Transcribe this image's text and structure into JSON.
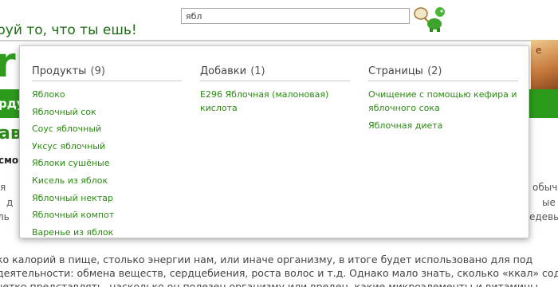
{
  "header": {
    "slogan": "руй то, что ты ешь!",
    "search": {
      "value": "ябл"
    }
  },
  "background": {
    "logo_letter": "r",
    "nav_label": "рду",
    "promo_text": "e",
    "heading": "ав",
    "subheading": "смо",
    "left_fragments": [
      "я",
      "д",
      "ль"
    ],
    "right_fragments": [
      "обыч",
      "ые",
      "едевы"
    ],
    "body_lines": [
      "ко калорий в пище, столько энергии нам, или иначе организму, в итоге будет использовано для под",
      "деятельности: обмена веществ, сердцебиения, роста волос и т.д. Однако мало знать, сколько «ккал» соде",
      "четко представлять, насколько он полезен организму или вреден, какие микроэлементы и витамины"
    ]
  },
  "dropdown": {
    "products": {
      "title": "Продукты",
      "count": "(9)",
      "items": [
        "Яблоко",
        "Яблочный сок",
        "Соус яблочный",
        "Уксус яблочный",
        "Яблоки сушёные",
        "Кисель из яблок",
        "Яблочный нектар",
        "Яблочный компот",
        "Варенье из яблок"
      ]
    },
    "additives": {
      "title": "Добавки",
      "count": "(1)",
      "items": [
        "E296 Яблочная (малоновая) кислота"
      ]
    },
    "pages": {
      "title": "Страницы",
      "count": "(2)",
      "items": [
        "Очищение с помощью кефира и яблочного сока",
        "Яблочная диета"
      ]
    }
  },
  "colors": {
    "link_green": "#2b8a12",
    "nav_green": "#2c9a1b",
    "slogan_green": "#1a6d12"
  }
}
